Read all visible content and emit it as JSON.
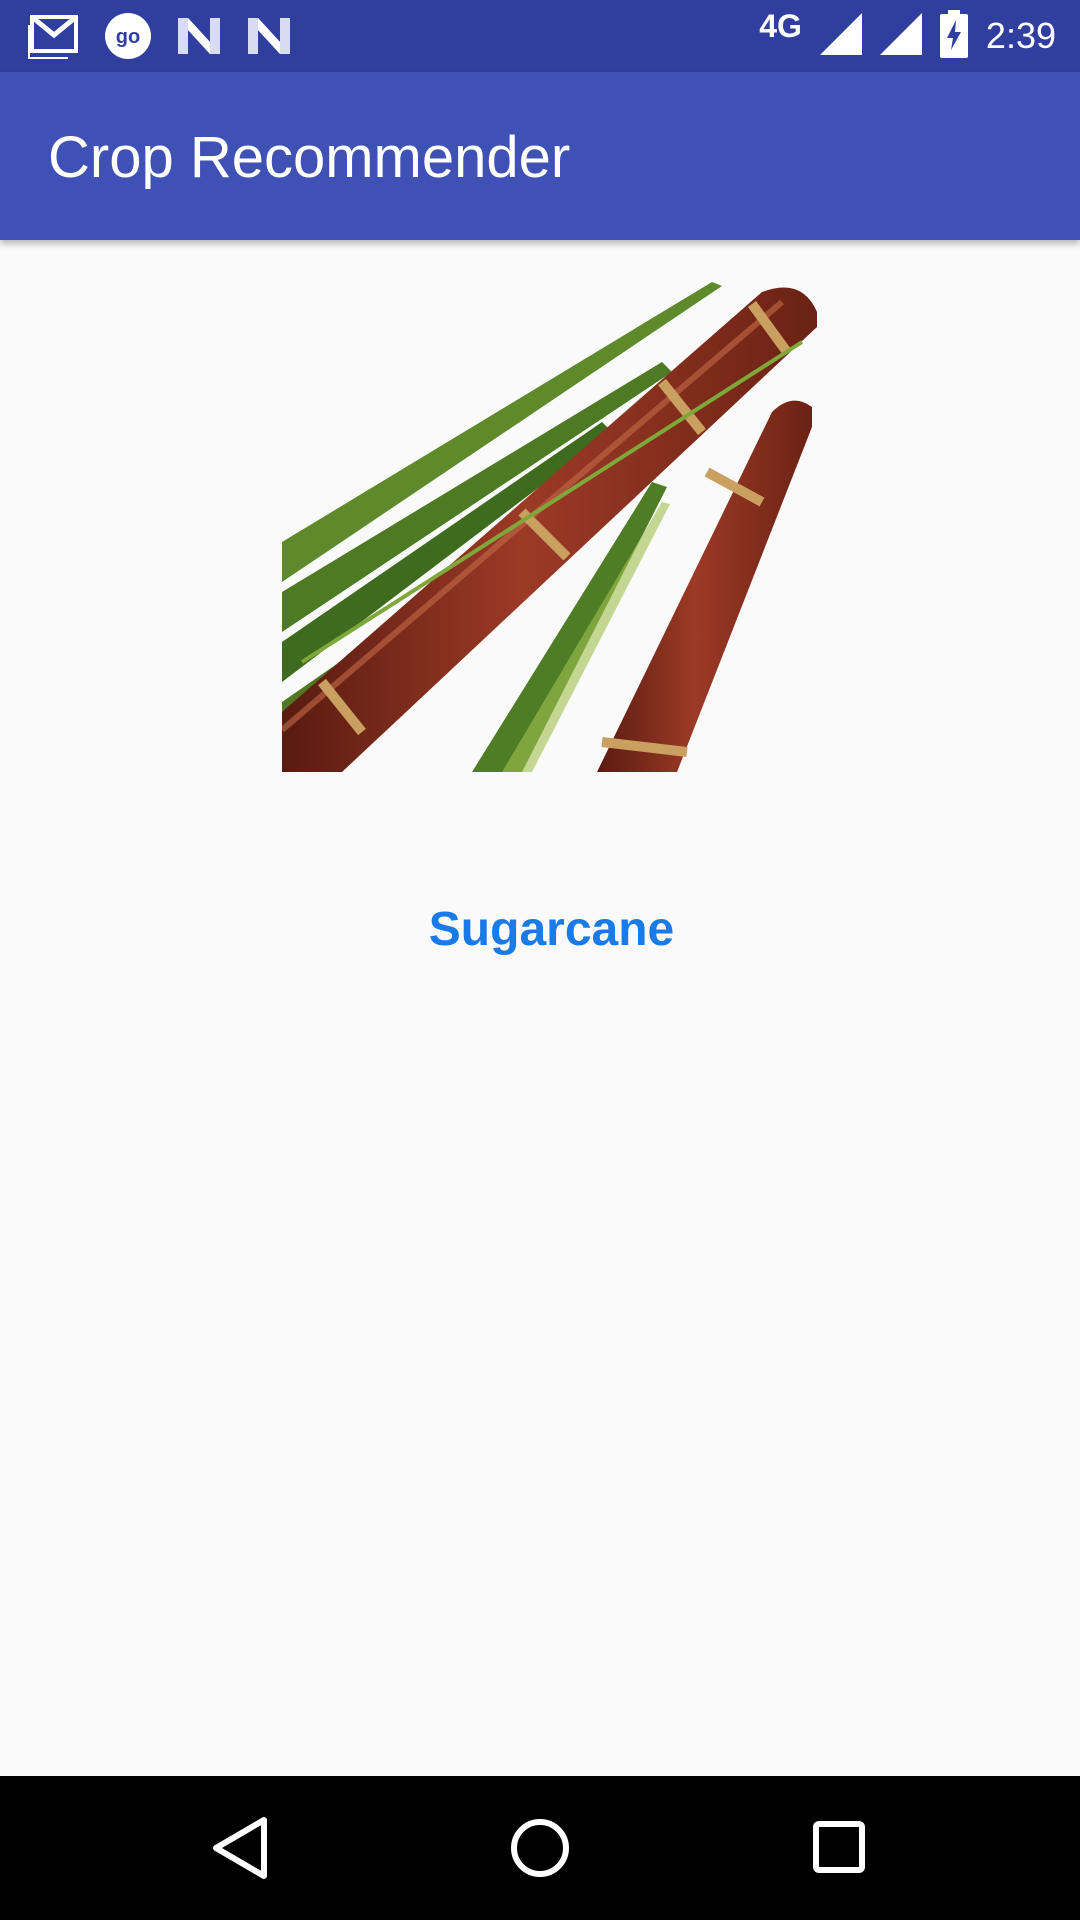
{
  "status_bar": {
    "network": "4G",
    "time": "2:39",
    "icons": [
      "gmail-icon",
      "go-icon",
      "n-icon",
      "n-icon",
      "signal-icon",
      "signal-icon",
      "battery-charging-icon"
    ]
  },
  "app_bar": {
    "title": "Crop Recommender"
  },
  "main": {
    "crop_image": "sugarcane-image",
    "crop_name": "Sugarcane"
  },
  "nav_bar": {
    "buttons": [
      "back-icon",
      "home-icon",
      "recents-icon"
    ]
  },
  "colors": {
    "status_bar": "#303f9f",
    "app_bar": "#3f51b5",
    "crop_name": "#1a7be8",
    "background": "#fafafa"
  }
}
